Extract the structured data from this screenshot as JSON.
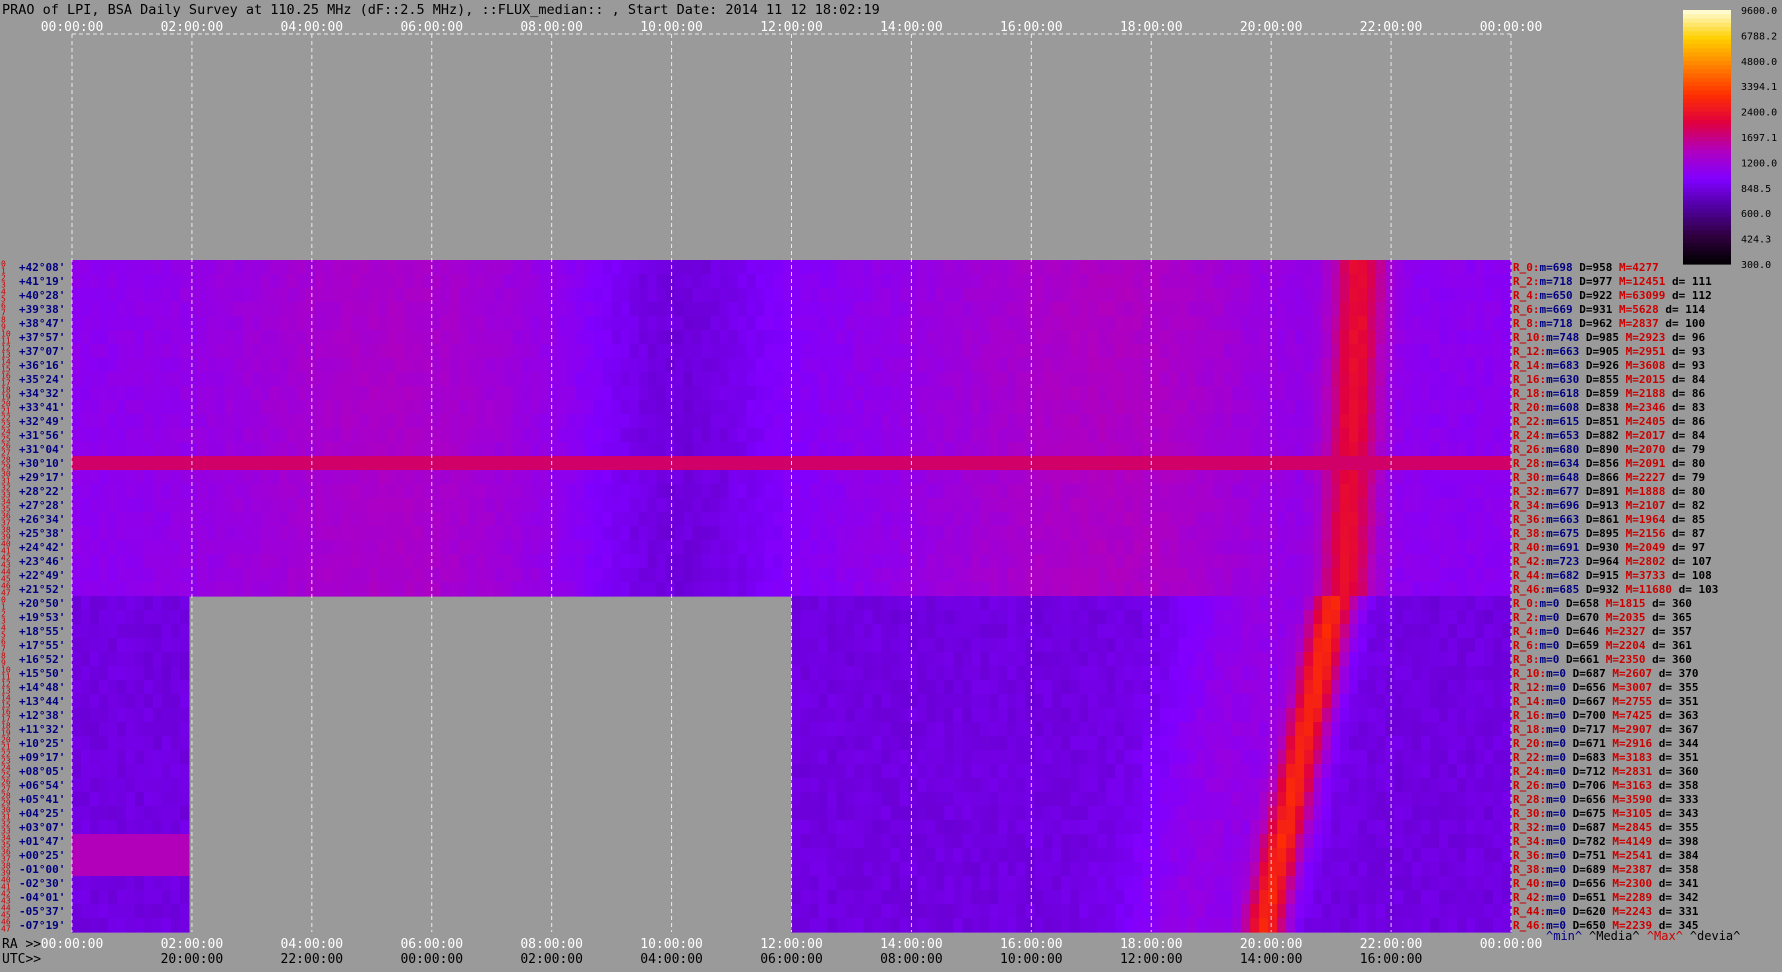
{
  "title": "PRAO of LPI, BSA Daily Survey at 110.25 MHz (dF::2.5 MHz), ::FLUX_median:: , Start Date: 2014 11 12 18:02:19",
  "bottom": {
    "ra_label": "RA >>",
    "utc_label": "UTC>>"
  },
  "chart_data": {
    "type": "heatmap",
    "title": "PRAO of LPI, BSA Daily Survey at 110.25 MHz (dF::2.5 MHz), ::FLUX_median:: , Start Date: 2014 11 12 18:02:19",
    "ra_top_ticks": [
      "00:00:00",
      "02:00:00",
      "04:00:00",
      "06:00:00",
      "08:00:00",
      "10:00:00",
      "12:00:00",
      "14:00:00",
      "16:00:00",
      "18:00:00",
      "20:00:00",
      "22:00:00",
      "00:00:00"
    ],
    "ra_bottom_ticks": [
      "00:00:00",
      "02:00:00",
      "04:00:00",
      "06:00:00",
      "08:00:00",
      "10:00:00",
      "12:00:00",
      "14:00:00",
      "16:00:00",
      "18:00:00",
      "20:00:00",
      "22:00:00",
      "00:00:00"
    ],
    "utc_ticks": [
      "20:00:00",
      "22:00:00",
      "00:00:00",
      "02:00:00",
      "04:00:00",
      "06:00:00",
      "08:00:00",
      "10:00:00",
      "12:00:00",
      "14:00:00",
      "16:00:00"
    ],
    "colorbar": {
      "ticks": [
        "9600.0",
        "6788.2",
        "4800.0",
        "3394.1",
        "2400.0",
        "1697.1",
        "1200.0",
        "848.5",
        "600.0",
        "424.3",
        "300.0"
      ]
    },
    "declinations_upper": [
      "+42°08'",
      "+41°19'",
      "+40°28'",
      "+39°38'",
      "+38°47'",
      "+37°57'",
      "+37°07'",
      "+36°16'",
      "+35°24'",
      "+34°32'",
      "+33°41'",
      "+32°49'",
      "+31°56'",
      "+31°04'",
      "+30°10'",
      "+29°17'",
      "+28°22'",
      "+27°28'",
      "+26°34'",
      "+25°38'",
      "+24°42'",
      "+23°46'",
      "+22°49'",
      "+21°52'"
    ],
    "declinations_lower": [
      "+20°50'",
      "+19°53'",
      "+18°55'",
      "+17°55'",
      "+16°52'",
      "+15°50'",
      "+14°48'",
      "+13°44'",
      "+12°38'",
      "+11°32'",
      "+10°25'",
      "+09°17'",
      "+08°05'",
      "+06°54'",
      "+05°41'",
      "+04°25'",
      "+03°07'",
      "+01°47'",
      "+00°25'",
      "-01°00'",
      "-02°30'",
      "-04°01'",
      "-05°37'",
      "-07°19'"
    ],
    "row_stats_upper": [
      {
        "r": "R_0:",
        "m": "698",
        "D": "958",
        "M": "4277",
        "d": ""
      },
      {
        "r": "R_2:",
        "m": "718",
        "D": "977",
        "M": "12451",
        "d": "111"
      },
      {
        "r": "R_4:",
        "m": "650",
        "D": "922",
        "M": "63099",
        "d": "112"
      },
      {
        "r": "R_6:",
        "m": "669",
        "D": "931",
        "M": "5628",
        "d": "114"
      },
      {
        "r": "R_8:",
        "m": "718",
        "D": "962",
        "M": "2837",
        "d": "100"
      },
      {
        "r": "R_10:",
        "m": "748",
        "D": "985",
        "M": "2923",
        "d": "96"
      },
      {
        "r": "R_12:",
        "m": "663",
        "D": "905",
        "M": "2951",
        "d": "93"
      },
      {
        "r": "R_14:",
        "m": "683",
        "D": "926",
        "M": "3608",
        "d": "93"
      },
      {
        "r": "R_16:",
        "m": "630",
        "D": "855",
        "M": "2015",
        "d": "84"
      },
      {
        "r": "R_18:",
        "m": "618",
        "D": "859",
        "M": "2188",
        "d": "86"
      },
      {
        "r": "R_20:",
        "m": "608",
        "D": "838",
        "M": "2346",
        "d": "83"
      },
      {
        "r": "R_22:",
        "m": "615",
        "D": "851",
        "M": "2405",
        "d": "86"
      },
      {
        "r": "R_24:",
        "m": "653",
        "D": "882",
        "M": "2017",
        "d": "84"
      },
      {
        "r": "R_26:",
        "m": "680",
        "D": "890",
        "M": "2070",
        "d": "79"
      },
      {
        "r": "R_28:",
        "m": "634",
        "D": "856",
        "M": "2091",
        "d": "80"
      },
      {
        "r": "R_30:",
        "m": "648",
        "D": "866",
        "M": "2227",
        "d": "79"
      },
      {
        "r": "R_32:",
        "m": "677",
        "D": "891",
        "M": "1888",
        "d": "80"
      },
      {
        "r": "R_34:",
        "m": "696",
        "D": "913",
        "M": "2107",
        "d": "82"
      },
      {
        "r": "R_36:",
        "m": "663",
        "D": "861",
        "M": "1964",
        "d": "85"
      },
      {
        "r": "R_38:",
        "m": "675",
        "D": "895",
        "M": "2156",
        "d": "87"
      },
      {
        "r": "R_40:",
        "m": "691",
        "D": "930",
        "M": "2049",
        "d": "97"
      },
      {
        "r": "R_42:",
        "m": "723",
        "D": "964",
        "M": "2802",
        "d": "107"
      },
      {
        "r": "R_44:",
        "m": "682",
        "D": "915",
        "M": "3733",
        "d": "108"
      },
      {
        "r": "R_46:",
        "m": "685",
        "D": "932",
        "M": "11680",
        "d": "103"
      }
    ],
    "row_stats_lower": [
      {
        "r": "R_0:",
        "m": "0",
        "D": "658",
        "M": "1815",
        "d": "360"
      },
      {
        "r": "R_2:",
        "m": "0",
        "D": "670",
        "M": "2035",
        "d": "365"
      },
      {
        "r": "R_4:",
        "m": "0",
        "D": "646",
        "M": "2327",
        "d": "357"
      },
      {
        "r": "R_6:",
        "m": "0",
        "D": "659",
        "M": "2204",
        "d": "361"
      },
      {
        "r": "R_8:",
        "m": "0",
        "D": "661",
        "M": "2350",
        "d": "360"
      },
      {
        "r": "R_10:",
        "m": "0",
        "D": "687",
        "M": "2607",
        "d": "370"
      },
      {
        "r": "R_12:",
        "m": "0",
        "D": "656",
        "M": "3007",
        "d": "355"
      },
      {
        "r": "R_14:",
        "m": "0",
        "D": "667",
        "M": "2755",
        "d": "351"
      },
      {
        "r": "R_16:",
        "m": "0",
        "D": "700",
        "M": "7425",
        "d": "363"
      },
      {
        "r": "R_18:",
        "m": "0",
        "D": "717",
        "M": "2907",
        "d": "367"
      },
      {
        "r": "R_20:",
        "m": "0",
        "D": "671",
        "M": "2916",
        "d": "344"
      },
      {
        "r": "R_22:",
        "m": "0",
        "D": "683",
        "M": "3183",
        "d": "351"
      },
      {
        "r": "R_24:",
        "m": "0",
        "D": "712",
        "M": "2831",
        "d": "360"
      },
      {
        "r": "R_26:",
        "m": "0",
        "D": "706",
        "M": "3163",
        "d": "358"
      },
      {
        "r": "R_28:",
        "m": "0",
        "D": "656",
        "M": "3590",
        "d": "333"
      },
      {
        "r": "R_30:",
        "m": "0",
        "D": "675",
        "M": "3105",
        "d": "343"
      },
      {
        "r": "R_32:",
        "m": "0",
        "D": "687",
        "M": "2845",
        "d": "355"
      },
      {
        "r": "R_34:",
        "m": "0",
        "D": "782",
        "M": "4149",
        "d": "398"
      },
      {
        "r": "R_36:",
        "m": "0",
        "D": "751",
        "M": "2541",
        "d": "384"
      },
      {
        "r": "R_38:",
        "m": "0",
        "D": "689",
        "M": "2387",
        "d": "358"
      },
      {
        "r": "R_40:",
        "m": "0",
        "D": "656",
        "M": "2300",
        "d": "341"
      },
      {
        "r": "R_42:",
        "m": "0",
        "D": "651",
        "M": "2289",
        "d": "342"
      },
      {
        "r": "R_44:",
        "m": "0",
        "D": "620",
        "M": "2243",
        "d": "331"
      },
      {
        "r": "R_46:",
        "m": "0",
        "D": "650",
        "M": "2239",
        "d": "345"
      }
    ],
    "legend_footer": [
      "^min^",
      "^Media^",
      "^Max^",
      "^devia^"
    ],
    "colormap": [
      "#000000",
      "#300040",
      "#5000a0",
      "#8000ff",
      "#b000c0",
      "#e00040",
      "#ff3000",
      "#ff8000",
      "#ffd000",
      "#ffffe0"
    ],
    "background_color": "#9a9a9a",
    "grid": true
  }
}
